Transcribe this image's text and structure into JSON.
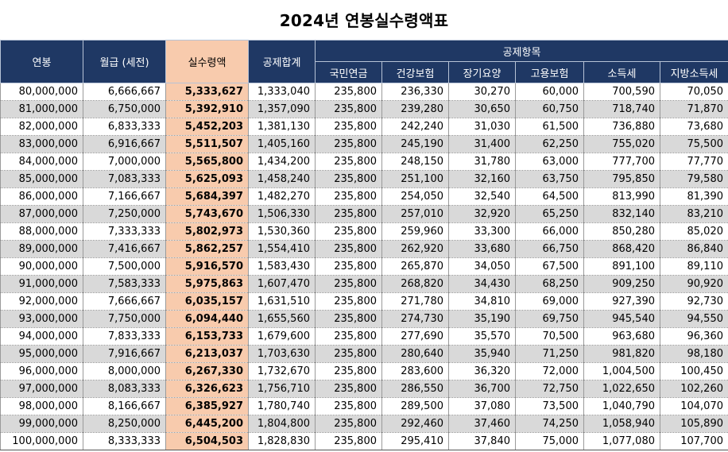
{
  "title": "2024년 연봉실수령액표",
  "headers": {
    "salary": "연봉",
    "monthly": "월급 (세전)",
    "net": "실수령액",
    "total_deduction": "공제합계",
    "deduction_group": "공제항목",
    "pension": "국민연금",
    "health": "건강보험",
    "longterm_care": "장기요양",
    "employment": "고용보험",
    "income_tax": "소득세",
    "local_tax": "지방소득세"
  },
  "colors": {
    "header_bg": "#1f3864",
    "highlight": "#f8cbad",
    "stripe": "#d9d9d9"
  },
  "rows": [
    [
      "80,000,000",
      "6,666,667",
      "5,333,627",
      "1,333,040",
      "235,800",
      "236,330",
      "30,270",
      "60,000",
      "700,590",
      "70,050"
    ],
    [
      "81,000,000",
      "6,750,000",
      "5,392,910",
      "1,357,090",
      "235,800",
      "239,280",
      "30,650",
      "60,750",
      "718,740",
      "71,870"
    ],
    [
      "82,000,000",
      "6,833,333",
      "5,452,203",
      "1,381,130",
      "235,800",
      "242,240",
      "31,030",
      "61,500",
      "736,880",
      "73,680"
    ],
    [
      "83,000,000",
      "6,916,667",
      "5,511,507",
      "1,405,160",
      "235,800",
      "245,190",
      "31,400",
      "62,250",
      "755,020",
      "75,500"
    ],
    [
      "84,000,000",
      "7,000,000",
      "5,565,800",
      "1,434,200",
      "235,800",
      "248,150",
      "31,780",
      "63,000",
      "777,700",
      "77,770"
    ],
    [
      "85,000,000",
      "7,083,333",
      "5,625,093",
      "1,458,240",
      "235,800",
      "251,100",
      "32,160",
      "63,750",
      "795,850",
      "79,580"
    ],
    [
      "86,000,000",
      "7,166,667",
      "5,684,397",
      "1,482,270",
      "235,800",
      "254,050",
      "32,540",
      "64,500",
      "813,990",
      "81,390"
    ],
    [
      "87,000,000",
      "7,250,000",
      "5,743,670",
      "1,506,330",
      "235,800",
      "257,010",
      "32,920",
      "65,250",
      "832,140",
      "83,210"
    ],
    [
      "88,000,000",
      "7,333,333",
      "5,802,973",
      "1,530,360",
      "235,800",
      "259,960",
      "33,300",
      "66,000",
      "850,280",
      "85,020"
    ],
    [
      "89,000,000",
      "7,416,667",
      "5,862,257",
      "1,554,410",
      "235,800",
      "262,920",
      "33,680",
      "66,750",
      "868,420",
      "86,840"
    ],
    [
      "90,000,000",
      "7,500,000",
      "5,916,570",
      "1,583,430",
      "235,800",
      "265,870",
      "34,050",
      "67,500",
      "891,100",
      "89,110"
    ],
    [
      "91,000,000",
      "7,583,333",
      "5,975,863",
      "1,607,470",
      "235,800",
      "268,820",
      "34,430",
      "68,250",
      "909,250",
      "90,920"
    ],
    [
      "92,000,000",
      "7,666,667",
      "6,035,157",
      "1,631,510",
      "235,800",
      "271,780",
      "34,810",
      "69,000",
      "927,390",
      "92,730"
    ],
    [
      "93,000,000",
      "7,750,000",
      "6,094,440",
      "1,655,560",
      "235,800",
      "274,730",
      "35,190",
      "69,750",
      "945,540",
      "94,550"
    ],
    [
      "94,000,000",
      "7,833,333",
      "6,153,733",
      "1,679,600",
      "235,800",
      "277,690",
      "35,570",
      "70,500",
      "963,680",
      "96,360"
    ],
    [
      "95,000,000",
      "7,916,667",
      "6,213,037",
      "1,703,630",
      "235,800",
      "280,640",
      "35,940",
      "71,250",
      "981,820",
      "98,180"
    ],
    [
      "96,000,000",
      "8,000,000",
      "6,267,330",
      "1,732,670",
      "235,800",
      "283,600",
      "36,320",
      "72,000",
      "1,004,500",
      "100,450"
    ],
    [
      "97,000,000",
      "8,083,333",
      "6,326,623",
      "1,756,710",
      "235,800",
      "286,550",
      "36,700",
      "72,750",
      "1,022,650",
      "102,260"
    ],
    [
      "98,000,000",
      "8,166,667",
      "6,385,927",
      "1,780,740",
      "235,800",
      "289,500",
      "37,080",
      "73,500",
      "1,040,790",
      "104,070"
    ],
    [
      "99,000,000",
      "8,250,000",
      "6,445,200",
      "1,804,800",
      "235,800",
      "292,460",
      "37,460",
      "74,250",
      "1,058,940",
      "105,890"
    ],
    [
      "100,000,000",
      "8,333,333",
      "6,504,503",
      "1,828,830",
      "235,800",
      "295,410",
      "37,840",
      "75,000",
      "1,077,080",
      "107,700"
    ]
  ]
}
